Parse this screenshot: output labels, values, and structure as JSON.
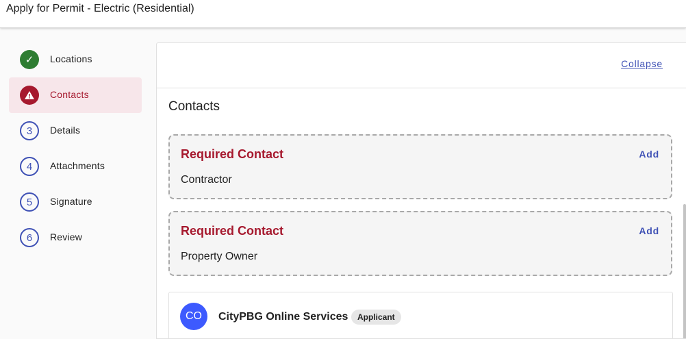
{
  "header": {
    "title": "Apply for Permit - Electric (Residential)"
  },
  "stepper": {
    "steps": [
      {
        "label": "Locations",
        "marker": "✓",
        "state": "complete",
        "icon": "check-icon"
      },
      {
        "label": "Contacts",
        "marker": "⚠",
        "state": "error",
        "icon": "warning-icon"
      },
      {
        "label": "Details",
        "marker": "3",
        "state": "pending"
      },
      {
        "label": "Attachments",
        "marker": "4",
        "state": "pending"
      },
      {
        "label": "Signature",
        "marker": "5",
        "state": "pending"
      },
      {
        "label": "Review",
        "marker": "6",
        "state": "pending"
      }
    ]
  },
  "panel": {
    "collapse_label": "Collapse",
    "section_title": "Contacts",
    "required_contacts": [
      {
        "title": "Required Contact",
        "add_label": "Add",
        "role": "Contractor"
      },
      {
        "title": "Required Contact",
        "add_label": "Add",
        "role": "Property Owner"
      }
    ],
    "contact": {
      "initials": "CO",
      "name": "CityPBG Online Services",
      "badge": "Applicant"
    }
  },
  "colors": {
    "accent": "#3f51b5",
    "error": "#a6192e",
    "success": "#2e7d32",
    "avatar": "#3d5afe"
  }
}
